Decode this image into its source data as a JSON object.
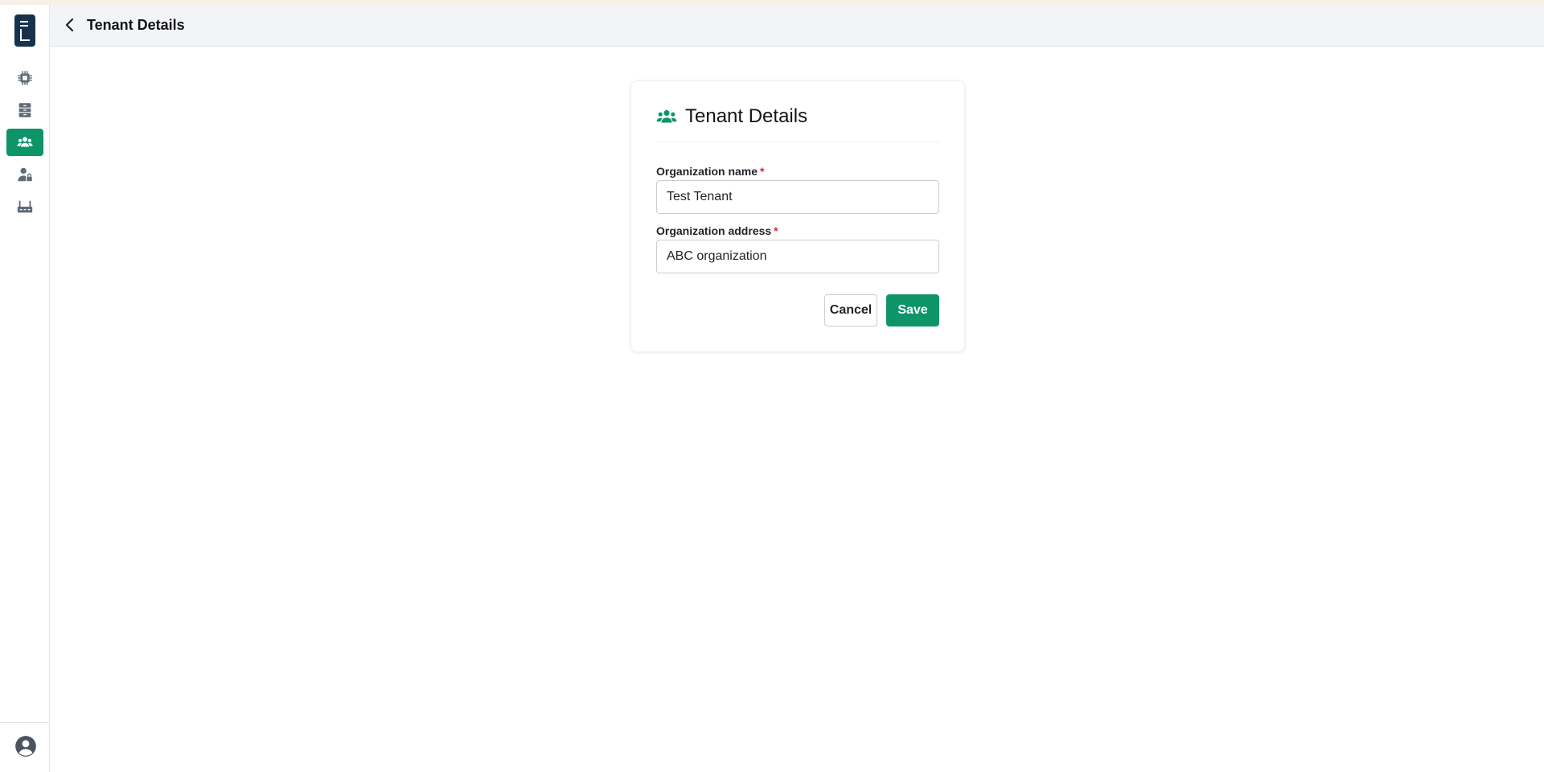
{
  "header": {
    "title": "Tenant Details",
    "back_icon": "chevron-left-icon"
  },
  "sidebar": {
    "logo": "app-logo",
    "items": [
      {
        "icon": "chip-icon",
        "active": false
      },
      {
        "icon": "server-icon",
        "active": false
      },
      {
        "icon": "users-icon",
        "active": true
      },
      {
        "icon": "user-lock-icon",
        "active": false
      },
      {
        "icon": "router-icon",
        "active": false
      }
    ],
    "user_icon": "user-circle-icon"
  },
  "card": {
    "title": "Tenant Details",
    "icon": "users-icon",
    "fields": {
      "org_name": {
        "label": "Organization name",
        "required_mark": "*",
        "value": "Test Tenant"
      },
      "org_address": {
        "label": "Organization address",
        "required_mark": "*",
        "value": "ABC organization"
      }
    },
    "cancel_label": "Cancel",
    "save_label": "Save"
  },
  "colors": {
    "accent": "#0e9469",
    "logo_bg": "#17324b",
    "header_bg": "#f3f4f6",
    "required": "#d62b2b"
  }
}
